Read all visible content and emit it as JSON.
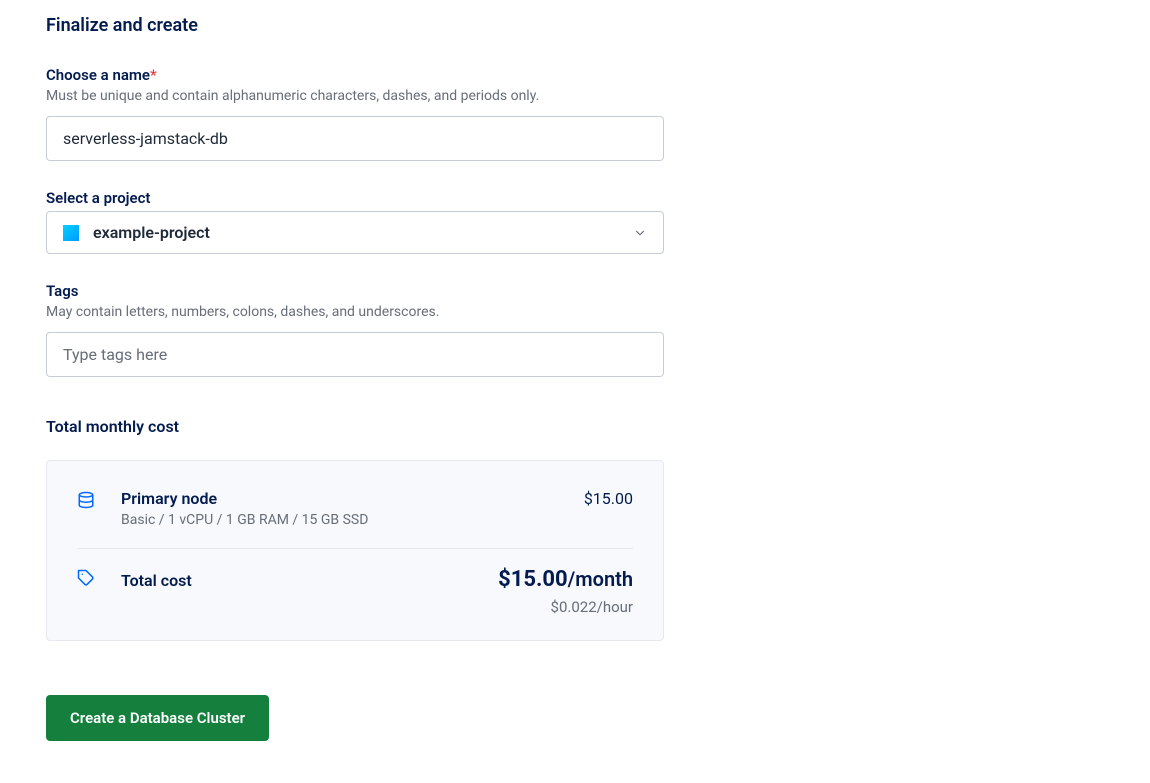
{
  "section_title": "Finalize and create",
  "form": {
    "name": {
      "label": "Choose a name",
      "required_mark": "*",
      "hint": "Must be unique and contain alphanumeric characters, dashes, and periods only.",
      "value": "serverless-jamstack-db"
    },
    "project": {
      "label": "Select a project",
      "selected": "example-project"
    },
    "tags": {
      "label": "Tags",
      "hint": "May contain letters, numbers, colons, dashes, and underscores.",
      "placeholder": "Type tags here"
    }
  },
  "cost": {
    "title": "Total monthly cost",
    "primary_node": {
      "label": "Primary node",
      "specs": "Basic / 1 vCPU / 1 GB RAM / 15 GB SSD",
      "price": "$15.00"
    },
    "total": {
      "label": "Total cost",
      "price": "$15.00",
      "unit": "/month",
      "hourly": "$0.022/hour"
    }
  },
  "create_button": "Create a Database Cluster"
}
